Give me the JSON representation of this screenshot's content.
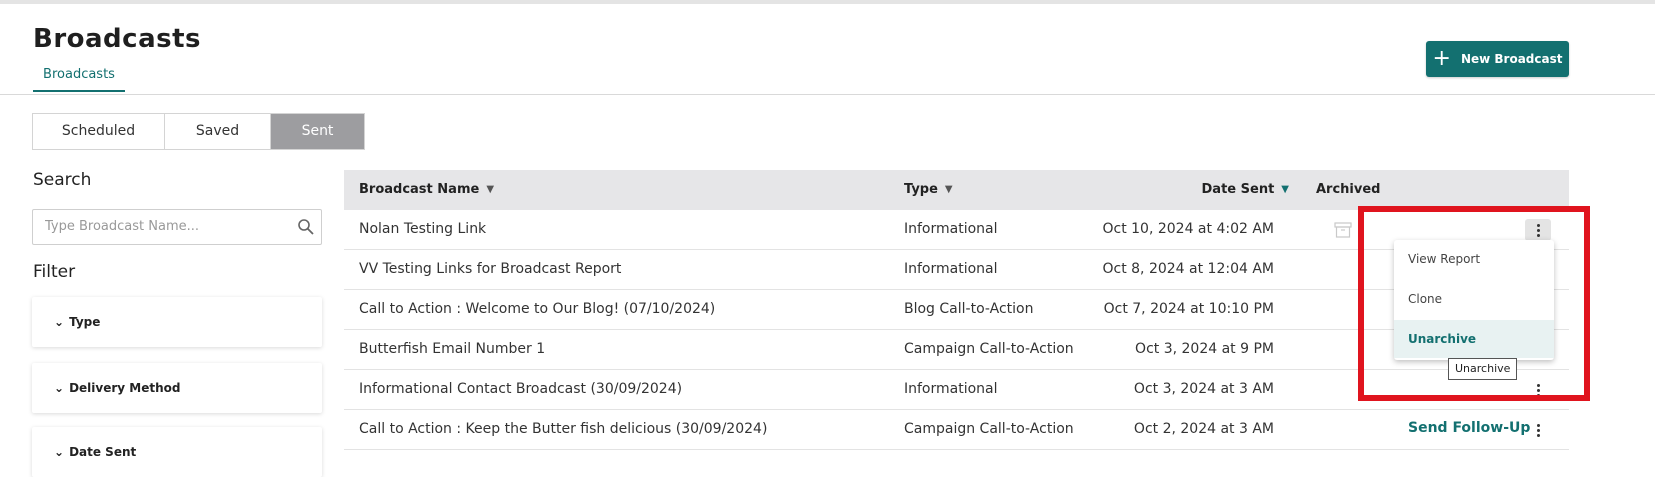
{
  "page": {
    "title": "Broadcasts",
    "subtab": "Broadcasts",
    "new_button": "New Broadcast"
  },
  "segments": [
    "Scheduled",
    "Saved",
    "Sent"
  ],
  "search": {
    "label": "Search",
    "placeholder": "Type Broadcast Name..."
  },
  "filter": {
    "label": "Filter",
    "groups": [
      "Type",
      "Delivery Method",
      "Date Sent"
    ]
  },
  "table": {
    "columns": [
      "Broadcast Name",
      "Type",
      "Date Sent",
      "Archived"
    ],
    "rows": [
      {
        "name": "Nolan Testing Link",
        "type": "Informational",
        "date": "Oct 10, 2024 at 4:02 AM"
      },
      {
        "name": "VV Testing Links for Broadcast Report",
        "type": "Informational",
        "date": "Oct 8, 2024 at 12:04 AM"
      },
      {
        "name": "Call to Action : Welcome to Our Blog! (07/10/2024)",
        "type": "Blog Call-to-Action",
        "date": "Oct 7, 2024 at 10:10 PM"
      },
      {
        "name": "Butterfish Email Number 1",
        "type": "Campaign Call-to-Action",
        "date": "Oct 3, 2024 at 9 PM"
      },
      {
        "name": "Informational Contact Broadcast (30/09/2024)",
        "type": "Informational",
        "date": "Oct 3, 2024 at 3 AM"
      },
      {
        "name": "Call to Action : Keep the Butter fish delicious (30/09/2024)",
        "type": "Campaign Call-to-Action",
        "date": "Oct 2, 2024 at 3 AM",
        "action": "Send Follow-Up"
      }
    ]
  },
  "menu": {
    "items": [
      "View Report",
      "Clone",
      "Unarchive"
    ],
    "tooltip": "Unarchive"
  },
  "colors": {
    "accent": "#137070",
    "highlight": "#e0141e"
  }
}
